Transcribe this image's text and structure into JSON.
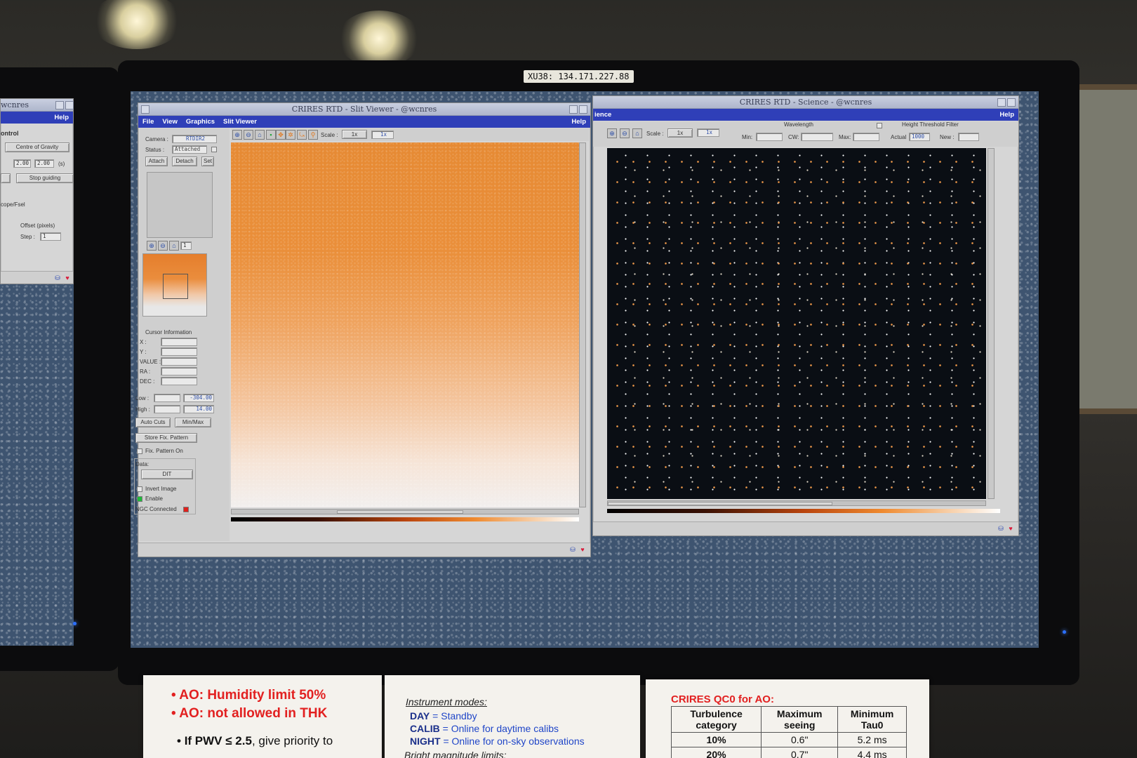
{
  "room": {
    "ip_label": "XU38: 134.171.227.88"
  },
  "left_window": {
    "title": "wcnres",
    "help": "Help",
    "section_label": "ontrol",
    "select_value": "Centre of Gravity",
    "field_a": "2.00",
    "field_b": "2.00",
    "unit": "(s)",
    "stop_button": "Stop guiding",
    "scope_label": "cope/Fsel",
    "offset_label": "Offset (pixels)",
    "step_label": "Step :",
    "step_value": "1"
  },
  "slit_viewer": {
    "title": "CRIRES RTD - Slit Viewer - @wcnres",
    "menu": [
      "File",
      "View",
      "Graphics",
      "Slit Viewer"
    ],
    "help": "Help",
    "camera_label": "Camera :",
    "camera_value": "RTDIR2",
    "status_label": "Status :",
    "status_value": "Attached",
    "attach": "Attach",
    "detach": "Detach",
    "set": "Set",
    "zoom_value": "1",
    "scale_label": "Scale :",
    "scale_value": "1x",
    "scale_value2": "1x",
    "cursor_info": "Cursor Information",
    "cursor_fields": [
      "X :",
      "Y :",
      "VALUE :",
      "RA :",
      "DEC :"
    ],
    "low_label": "Low :",
    "low_value": "-304.00",
    "high_label": "High :",
    "high_value": "14.00",
    "auto_cuts": "Auto Cuts",
    "min_max": "Min/Max",
    "store_fix": "Store Fix. Pattern",
    "fix_on": "Fix. Pattern On",
    "data_label": "Data:",
    "data_select": "DIT",
    "invert": "Invert Image",
    "enable": "Enable",
    "ngc": "NGC Connected"
  },
  "science": {
    "title": "CRIRES RTD - Science - @wcnres",
    "menu_partial": "ience",
    "help": "Help",
    "scale_label": "Scale :",
    "scale_value": "1x",
    "scale_value2": "1x",
    "wavelength": "Wavelength",
    "min_label": "Min:",
    "cw_label": "CW:",
    "max_label": "Max:",
    "height_filter": "Height Threshold Filter",
    "actual_label": "Actual",
    "actual_value": "1000",
    "new_label": "New :"
  },
  "notes": {
    "left": {
      "line1": "AO: Humidity limit 50%",
      "line2": "AO: not allowed in THK",
      "line3_pre": "If PWV ",
      "line3_sym": "≤ 2.5",
      "line3_post": ", give priority to"
    },
    "middle": {
      "heading": "Instrument modes:",
      "modes": [
        {
          "key": "DAY",
          "text": "= Standby"
        },
        {
          "key": "CALIB",
          "text": "= Online for daytime calibs"
        },
        {
          "key": "NIGHT",
          "text": "= Online for on-sky observations"
        }
      ],
      "footer": "Bright magnitude limits:"
    },
    "right": {
      "heading": "CRIRES QC0 for AO:",
      "columns": [
        "Turbulence category",
        "Maximum seeing",
        "Minimum Tau0"
      ],
      "rows": [
        [
          "10%",
          "0.6\"",
          "5.2 ms"
        ],
        [
          "20%",
          "0.7\"",
          "4.4 ms"
        ]
      ]
    }
  }
}
